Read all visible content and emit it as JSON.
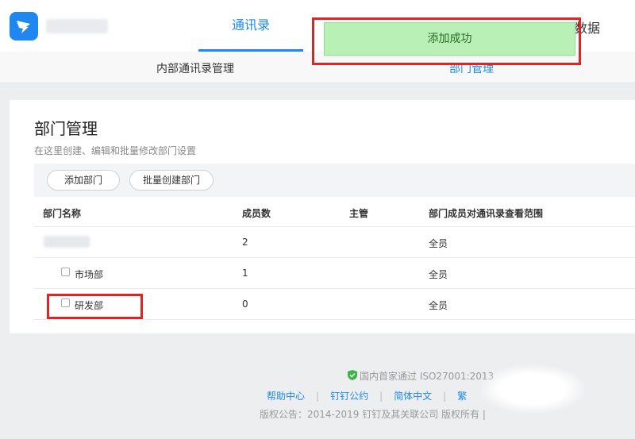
{
  "header": {
    "main_tab": "通讯录",
    "right_tab_partial": "数据",
    "right_tab_fragment": "",
    "subnav_left": "内部通讯录管理",
    "subnav_right": "部门管理"
  },
  "toast": {
    "message": "添加成功"
  },
  "page": {
    "title": "部门管理",
    "description": "在这里创建、编辑和批量修改部门设置"
  },
  "toolbar": {
    "add_label": "添加部门",
    "batch_label": "批量创建部门"
  },
  "table": {
    "headers": [
      "部门名称",
      "成员数",
      "主管",
      "部门成员对通讯录查看范围"
    ],
    "rows": [
      {
        "name": "",
        "count": "2",
        "lead": "",
        "scope": "全员"
      },
      {
        "name": "市场部",
        "count": "1",
        "lead": "",
        "scope": "全员"
      },
      {
        "name": "研发部",
        "count": "0",
        "lead": "",
        "scope": "全员"
      }
    ]
  },
  "footer": {
    "cert_text": "国内首家通过 ISO27001:2013",
    "links": [
      "帮助中心",
      "钉钉公约",
      "简体中文",
      "繁"
    ],
    "copyright": "版权公告：2014-2019 钉钉及其关联公司 版权所有 |"
  },
  "colors": {
    "accent": "#1e88f0",
    "toast_bg": "#b9f0b5",
    "highlight": "#e32222"
  }
}
